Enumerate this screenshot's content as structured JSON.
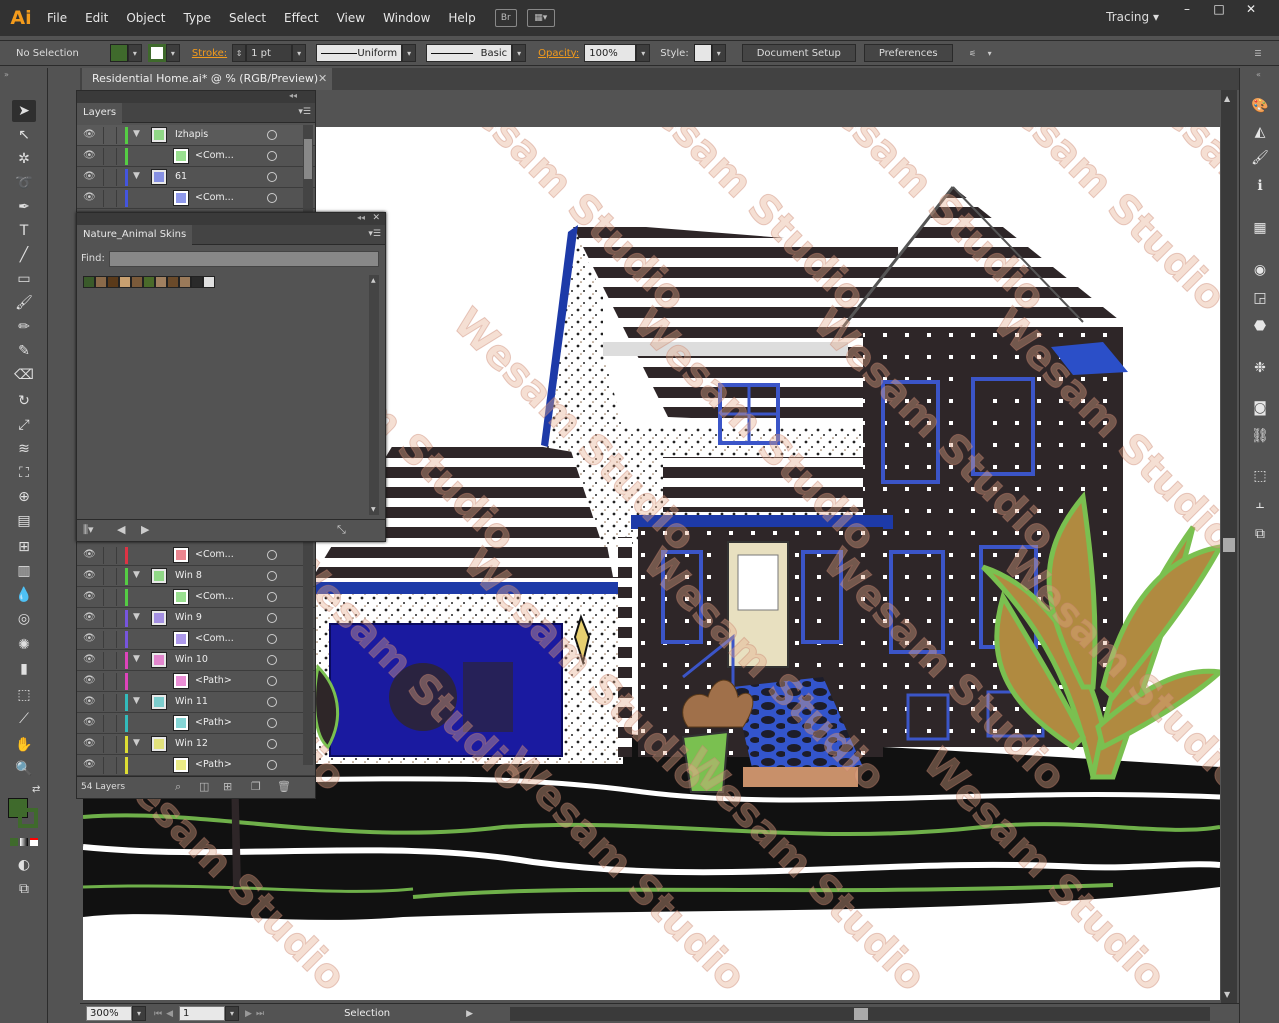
{
  "app": {
    "logo": "Ai",
    "workspace": "Tracing",
    "bridge_label": "Br"
  },
  "menu": [
    "File",
    "Edit",
    "Object",
    "Type",
    "Select",
    "Effect",
    "View",
    "Window",
    "Help"
  ],
  "window_controls": {
    "minimize": "–",
    "maximize": "□",
    "close": "✕"
  },
  "control_bar": {
    "selection_status": "No Selection",
    "stroke_label": "Stroke:",
    "stroke_weight": "1 pt",
    "profile": "Uniform",
    "brush": "Basic",
    "opacity_label": "Opacity:",
    "opacity": "100%",
    "style_label": "Style:",
    "document_setup": "Document Setup",
    "preferences": "Preferences"
  },
  "document": {
    "tab_title": "Residential Home.ai* @ % (RGB/Preview)",
    "close": "✕"
  },
  "layers_panel": {
    "title": "Layers",
    "top_rows": [
      {
        "name": "Izhapis",
        "color": "#55cc44",
        "expanded": true,
        "indent": 0
      },
      {
        "name": "<Com...",
        "color": "#55cc44",
        "expanded": false,
        "indent": 1
      },
      {
        "name": "61",
        "color": "#4455dd",
        "expanded": true,
        "indent": 0
      },
      {
        "name": "<Com...",
        "color": "#4455dd",
        "expanded": false,
        "indent": 1
      }
    ],
    "bottom_rows": [
      {
        "name": "<Com...",
        "color": "#dd3344",
        "expanded": false,
        "indent": 1
      },
      {
        "name": "Win 8",
        "color": "#55cc44",
        "expanded": true,
        "indent": 0
      },
      {
        "name": "<Com...",
        "color": "#55cc44",
        "expanded": false,
        "indent": 1
      },
      {
        "name": "Win 9",
        "color": "#7755dd",
        "expanded": true,
        "indent": 0
      },
      {
        "name": "<Com...",
        "color": "#7755dd",
        "expanded": false,
        "indent": 1
      },
      {
        "name": "Win 10",
        "color": "#dd44bb",
        "expanded": true,
        "indent": 0
      },
      {
        "name": "<Path>",
        "color": "#dd44bb",
        "expanded": false,
        "indent": 1
      },
      {
        "name": "Win 11",
        "color": "#33bbbb",
        "expanded": true,
        "indent": 0
      },
      {
        "name": "<Path>",
        "color": "#33bbbb",
        "expanded": false,
        "indent": 1
      },
      {
        "name": "Win 12",
        "color": "#dddd33",
        "expanded": true,
        "indent": 0
      },
      {
        "name": "<Path>",
        "color": "#dddd33",
        "expanded": false,
        "indent": 1
      }
    ],
    "footer_count": "54 Layers"
  },
  "swatches_panel": {
    "title": "Nature_Animal Skins",
    "find_label": "Find:",
    "find_value": "",
    "swatch_colors": [
      "#3a5a2a",
      "#8a6a4a",
      "#5a3a1a",
      "#c8a070",
      "#7a5a3a",
      "#4a6a2a",
      "#a08060",
      "#6a4a2a",
      "#9a7a5a",
      "#2a2a2a",
      "#e0e0e0"
    ]
  },
  "status_bar": {
    "zoom": "300%",
    "page": "1",
    "mode": "Selection"
  },
  "watermark": {
    "text": "Wesam Studio"
  }
}
